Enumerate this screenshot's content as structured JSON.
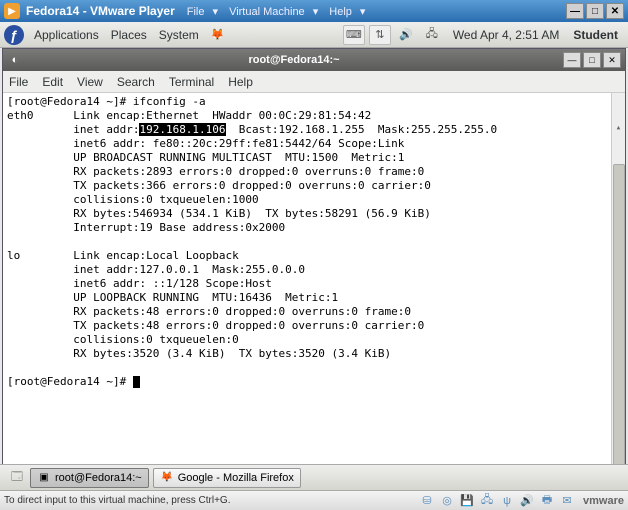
{
  "vmware": {
    "title": "Fedora14 - VMware Player",
    "menu": {
      "file": "File",
      "vm": "Virtual Machine",
      "help": "Help"
    },
    "status_hint": "To direct input to this virtual machine, press Ctrl+G.",
    "logo": "vmware"
  },
  "gnome": {
    "top": {
      "apps": "Applications",
      "places": "Places",
      "system": "System",
      "clock": "Wed Apr 4,  2:51 AM",
      "user": "Student"
    },
    "bottom": {
      "term_task": "root@Fedora14:~",
      "ff_task": "Google - Mozilla Firefox"
    }
  },
  "terminal": {
    "title": "root@Fedora14:~",
    "menu": {
      "file": "File",
      "edit": "Edit",
      "view": "View",
      "search": "Search",
      "terminal": "Terminal",
      "help": "Help"
    },
    "prompt1": "[root@Fedora14 ~]# ifconfig -a",
    "eth0": {
      "line1": "eth0      Link encap:Ethernet  HWaddr 00:0C:29:81:54:42",
      "line2a": "          inet addr:",
      "line2_hl": "192.168.1.106",
      "line2b": "  Bcast:192.168.1.255  Mask:255.255.255.0",
      "line3": "          inet6 addr: fe80::20c:29ff:fe81:5442/64 Scope:Link",
      "line4": "          UP BROADCAST RUNNING MULTICAST  MTU:1500  Metric:1",
      "line5": "          RX packets:2893 errors:0 dropped:0 overruns:0 frame:0",
      "line6": "          TX packets:366 errors:0 dropped:0 overruns:0 carrier:0",
      "line7": "          collisions:0 txqueuelen:1000",
      "line8": "          RX bytes:546934 (534.1 KiB)  TX bytes:58291 (56.9 KiB)",
      "line9": "          Interrupt:19 Base address:0x2000"
    },
    "lo": {
      "line1": "lo        Link encap:Local Loopback",
      "line2": "          inet addr:127.0.0.1  Mask:255.0.0.0",
      "line3": "          inet6 addr: ::1/128 Scope:Host",
      "line4": "          UP LOOPBACK RUNNING  MTU:16436  Metric:1",
      "line5": "          RX packets:48 errors:0 dropped:0 overruns:0 frame:0",
      "line6": "          TX packets:48 errors:0 dropped:0 overruns:0 carrier:0",
      "line7": "          collisions:0 txqueuelen:0",
      "line8": "          RX bytes:3520 (3.4 KiB)  TX bytes:3520 (3.4 KiB)"
    },
    "prompt2": "[root@Fedora14 ~]# "
  }
}
